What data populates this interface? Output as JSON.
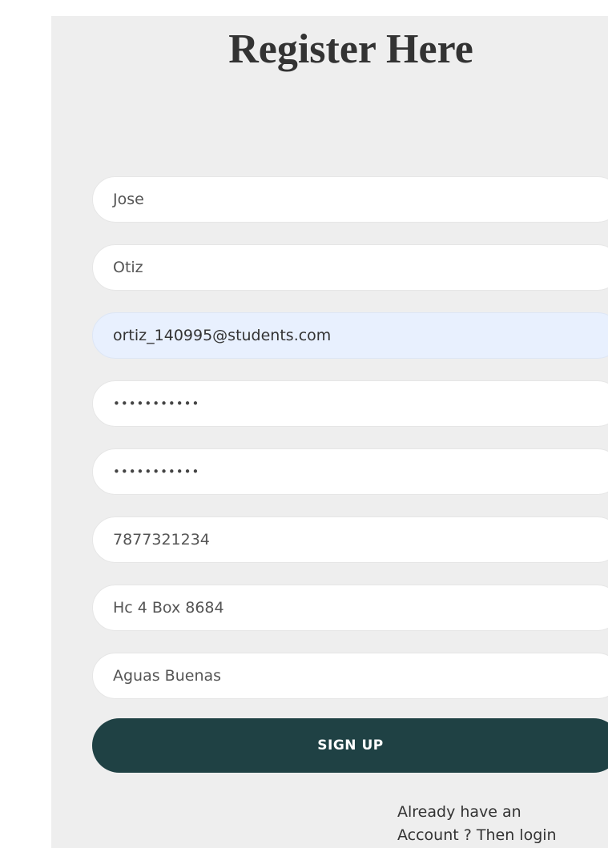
{
  "form": {
    "title": "Register Here",
    "fields": {
      "first_name": "Jose",
      "last_name": "Otiz",
      "email": "ortiz_140995@students.com",
      "password": "•••••••••••",
      "confirm_password": "•••••••••••",
      "phone": "7877321234",
      "address": "Hc 4  Box 8684",
      "city": "Aguas Buenas"
    },
    "submit_label": "SIGN UP",
    "login_prompt_line1": "Already have an",
    "login_prompt_line2": "Account ? Then login"
  },
  "colors": {
    "panel_bg": "#eeeeee",
    "button_bg": "#1f4144",
    "autofill_bg": "#e8f0fe"
  }
}
